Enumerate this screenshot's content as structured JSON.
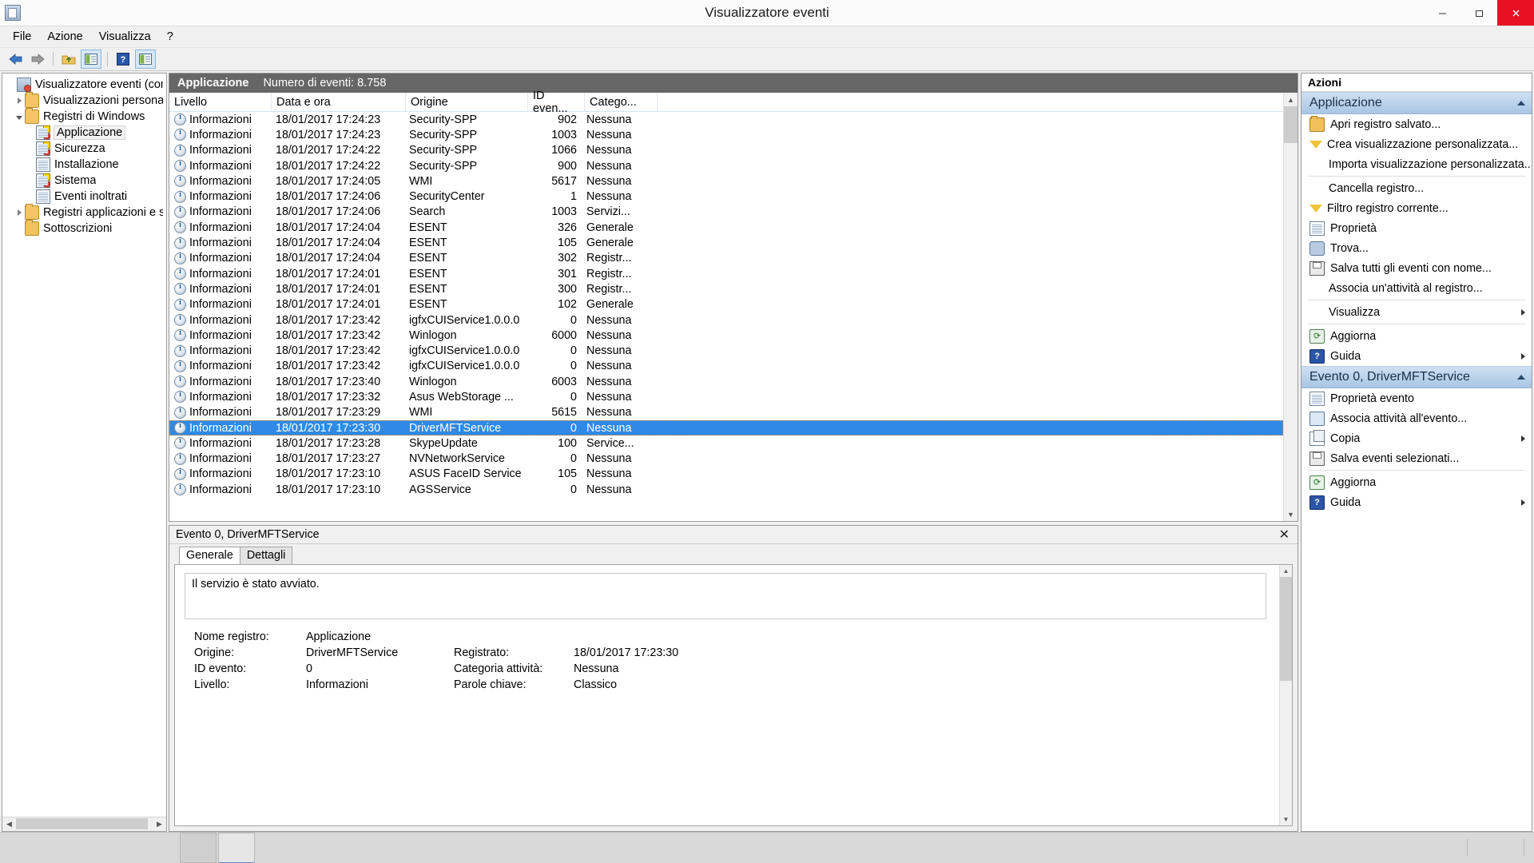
{
  "window": {
    "title": "Visualizzatore eventi",
    "icon": "event-viewer-icon",
    "minimize": "–",
    "maximize": "❐",
    "close": "✕"
  },
  "menu": {
    "items": [
      {
        "label": "File"
      },
      {
        "label": "Azione"
      },
      {
        "label": "Visualizza"
      },
      {
        "label": "?"
      }
    ]
  },
  "toolbar": {
    "buttons": [
      {
        "name": "back-button",
        "icon": "back-arrow-icon"
      },
      {
        "name": "forward-button",
        "icon": "forward-arrow-icon"
      },
      {
        "name": "up-folder-button",
        "icon": "folder-up-icon"
      },
      {
        "name": "show-hide-tree-button",
        "icon": "show-tree-icon"
      },
      {
        "name": "help-button",
        "icon": "help-icon"
      },
      {
        "name": "show-action-pane-button",
        "icon": "action-pane-icon"
      }
    ]
  },
  "tree": {
    "nodes": [
      {
        "label": "Visualizzatore eventi (computer",
        "indent": 0,
        "expander": "none",
        "icon": "event-viewer-icon",
        "selected": false
      },
      {
        "label": "Visualizzazioni personalizzate",
        "indent": 1,
        "expander": "closed",
        "icon": "custom-views-folder-icon",
        "selected": false
      },
      {
        "label": "Registri di Windows",
        "indent": 1,
        "expander": "open",
        "icon": "windows-logs-folder-icon",
        "selected": false
      },
      {
        "label": "Applicazione",
        "indent": 2,
        "expander": "none",
        "icon": "log-warning-icon",
        "selected": true
      },
      {
        "label": "Sicurezza",
        "indent": 2,
        "expander": "none",
        "icon": "log-warning-icon",
        "selected": false
      },
      {
        "label": "Installazione",
        "indent": 2,
        "expander": "none",
        "icon": "log-icon",
        "selected": false
      },
      {
        "label": "Sistema",
        "indent": 2,
        "expander": "none",
        "icon": "log-warning-icon",
        "selected": false
      },
      {
        "label": "Eventi inoltrati",
        "indent": 2,
        "expander": "none",
        "icon": "log-icon",
        "selected": false
      },
      {
        "label": "Registri applicazioni e servizi",
        "indent": 1,
        "expander": "closed",
        "icon": "app-logs-folder-icon",
        "selected": false
      },
      {
        "label": "Sottoscrizioni",
        "indent": 1,
        "expander": "none",
        "icon": "subscriptions-icon",
        "selected": false
      }
    ]
  },
  "list": {
    "log_name": "Applicazione",
    "event_count_label": "Numero di eventi: 8.758",
    "columns": [
      "Livello",
      "Data e ora",
      "Origine",
      "ID even...",
      "Catego..."
    ],
    "rows": [
      {
        "level": "Informazioni",
        "datetime": "18/01/2017 17:24:23",
        "source": "Security-SPP",
        "id": "902",
        "category": "Nessuna",
        "selected": false
      },
      {
        "level": "Informazioni",
        "datetime": "18/01/2017 17:24:23",
        "source": "Security-SPP",
        "id": "1003",
        "category": "Nessuna",
        "selected": false
      },
      {
        "level": "Informazioni",
        "datetime": "18/01/2017 17:24:22",
        "source": "Security-SPP",
        "id": "1066",
        "category": "Nessuna",
        "selected": false
      },
      {
        "level": "Informazioni",
        "datetime": "18/01/2017 17:24:22",
        "source": "Security-SPP",
        "id": "900",
        "category": "Nessuna",
        "selected": false
      },
      {
        "level": "Informazioni",
        "datetime": "18/01/2017 17:24:05",
        "source": "WMI",
        "id": "5617",
        "category": "Nessuna",
        "selected": false
      },
      {
        "level": "Informazioni",
        "datetime": "18/01/2017 17:24:06",
        "source": "SecurityCenter",
        "id": "1",
        "category": "Nessuna",
        "selected": false
      },
      {
        "level": "Informazioni",
        "datetime": "18/01/2017 17:24:06",
        "source": "Search",
        "id": "1003",
        "category": "Servizi...",
        "selected": false
      },
      {
        "level": "Informazioni",
        "datetime": "18/01/2017 17:24:04",
        "source": "ESENT",
        "id": "326",
        "category": "Generale",
        "selected": false
      },
      {
        "level": "Informazioni",
        "datetime": "18/01/2017 17:24:04",
        "source": "ESENT",
        "id": "105",
        "category": "Generale",
        "selected": false
      },
      {
        "level": "Informazioni",
        "datetime": "18/01/2017 17:24:04",
        "source": "ESENT",
        "id": "302",
        "category": "Registr...",
        "selected": false
      },
      {
        "level": "Informazioni",
        "datetime": "18/01/2017 17:24:01",
        "source": "ESENT",
        "id": "301",
        "category": "Registr...",
        "selected": false
      },
      {
        "level": "Informazioni",
        "datetime": "18/01/2017 17:24:01",
        "source": "ESENT",
        "id": "300",
        "category": "Registr...",
        "selected": false
      },
      {
        "level": "Informazioni",
        "datetime": "18/01/2017 17:24:01",
        "source": "ESENT",
        "id": "102",
        "category": "Generale",
        "selected": false
      },
      {
        "level": "Informazioni",
        "datetime": "18/01/2017 17:23:42",
        "source": "igfxCUIService1.0.0.0",
        "id": "0",
        "category": "Nessuna",
        "selected": false
      },
      {
        "level": "Informazioni",
        "datetime": "18/01/2017 17:23:42",
        "source": "Winlogon",
        "id": "6000",
        "category": "Nessuna",
        "selected": false
      },
      {
        "level": "Informazioni",
        "datetime": "18/01/2017 17:23:42",
        "source": "igfxCUIService1.0.0.0",
        "id": "0",
        "category": "Nessuna",
        "selected": false
      },
      {
        "level": "Informazioni",
        "datetime": "18/01/2017 17:23:42",
        "source": "igfxCUIService1.0.0.0",
        "id": "0",
        "category": "Nessuna",
        "selected": false
      },
      {
        "level": "Informazioni",
        "datetime": "18/01/2017 17:23:40",
        "source": "Winlogon",
        "id": "6003",
        "category": "Nessuna",
        "selected": false
      },
      {
        "level": "Informazioni",
        "datetime": "18/01/2017 17:23:32",
        "source": "Asus WebStorage ...",
        "id": "0",
        "category": "Nessuna",
        "selected": false
      },
      {
        "level": "Informazioni",
        "datetime": "18/01/2017 17:23:29",
        "source": "WMI",
        "id": "5615",
        "category": "Nessuna",
        "selected": false
      },
      {
        "level": "Informazioni",
        "datetime": "18/01/2017 17:23:30",
        "source": "DriverMFTService",
        "id": "0",
        "category": "Nessuna",
        "selected": true
      },
      {
        "level": "Informazioni",
        "datetime": "18/01/2017 17:23:28",
        "source": "SkypeUpdate",
        "id": "100",
        "category": "Service...",
        "selected": false
      },
      {
        "level": "Informazioni",
        "datetime": "18/01/2017 17:23:27",
        "source": "NVNetworkService",
        "id": "0",
        "category": "Nessuna",
        "selected": false
      },
      {
        "level": "Informazioni",
        "datetime": "18/01/2017 17:23:10",
        "source": "ASUS FaceID Service",
        "id": "105",
        "category": "Nessuna",
        "selected": false
      },
      {
        "level": "Informazioni",
        "datetime": "18/01/2017 17:23:10",
        "source": "AGSService",
        "id": "0",
        "category": "Nessuna",
        "selected": false
      }
    ]
  },
  "detail": {
    "header": "Evento 0, DriverMFTService",
    "close_label": "✕",
    "tabs": [
      {
        "label": "Generale",
        "active": true
      },
      {
        "label": "Dettagli",
        "active": false
      }
    ],
    "message": "Il servizio è stato avviato.",
    "fields": [
      {
        "label": "Nome registro:",
        "value": "Applicazione",
        "label2": "",
        "value2": ""
      },
      {
        "label": "Origine:",
        "value": "DriverMFTService",
        "label2": "Registrato:",
        "value2": "18/01/2017 17:23:30"
      },
      {
        "label": "ID evento:",
        "value": "0",
        "label2": "Categoria attività:",
        "value2": "Nessuna"
      },
      {
        "label": "Livello:",
        "value": "Informazioni",
        "label2": "Parole chiave:",
        "value2": "Classico"
      }
    ]
  },
  "actions": {
    "title": "Azioni",
    "groups": [
      {
        "title": "Applicazione",
        "collapse_icon": "chevron-up-icon",
        "items": [
          {
            "label": "Apri registro salvato...",
            "icon": "open-log-icon",
            "submenu": false,
            "separator_after": false
          },
          {
            "label": "Crea visualizzazione personalizzata...",
            "icon": "filter-icon",
            "submenu": false,
            "separator_after": false
          },
          {
            "label": "Importa visualizzazione personalizzata...",
            "icon": "none",
            "submenu": false,
            "separator_after": true
          },
          {
            "label": "Cancella registro...",
            "icon": "none",
            "submenu": false,
            "separator_after": false
          },
          {
            "label": "Filtro registro corrente...",
            "icon": "filter-icon",
            "submenu": false,
            "separator_after": false
          },
          {
            "label": "Proprietà",
            "icon": "properties-icon",
            "submenu": false,
            "separator_after": false
          },
          {
            "label": "Trova...",
            "icon": "find-icon",
            "submenu": false,
            "separator_after": false
          },
          {
            "label": "Salva tutti gli eventi con nome...",
            "icon": "save-icon",
            "submenu": false,
            "separator_after": false
          },
          {
            "label": "Associa un'attività al registro...",
            "icon": "none",
            "submenu": false,
            "separator_after": true
          },
          {
            "label": "Visualizza",
            "icon": "none",
            "submenu": true,
            "separator_after": true
          },
          {
            "label": "Aggiorna",
            "icon": "refresh-icon",
            "submenu": false,
            "separator_after": false
          },
          {
            "label": "Guida",
            "icon": "help-icon",
            "submenu": true,
            "separator_after": false
          }
        ]
      },
      {
        "title": "Evento 0, DriverMFTService",
        "collapse_icon": "chevron-up-icon",
        "items": [
          {
            "label": "Proprietà evento",
            "icon": "properties-icon",
            "submenu": false,
            "separator_after": false
          },
          {
            "label": "Associa attività all'evento...",
            "icon": "attach-task-icon",
            "submenu": false,
            "separator_after": false
          },
          {
            "label": "Copia",
            "icon": "copy-icon",
            "submenu": true,
            "separator_after": false
          },
          {
            "label": "Salva eventi selezionati...",
            "icon": "save-icon",
            "submenu": false,
            "separator_after": true
          },
          {
            "label": "Aggiorna",
            "icon": "refresh-icon",
            "submenu": false,
            "separator_after": false
          },
          {
            "label": "Guida",
            "icon": "help-icon",
            "submenu": true,
            "separator_after": false
          }
        ]
      }
    ]
  }
}
